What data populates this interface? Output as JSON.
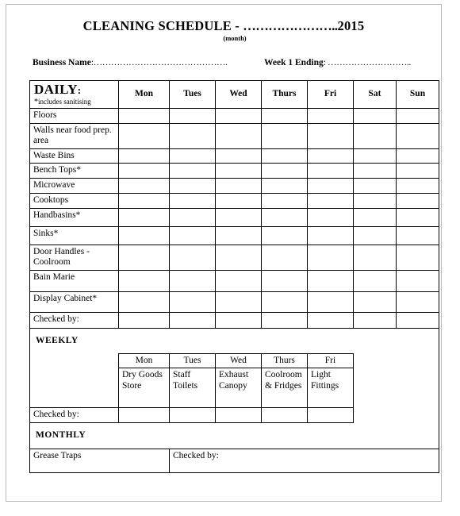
{
  "document": {
    "title_prefix": "CLEANING SCHEDULE - ",
    "title_dots": "…………………..",
    "title_year": "2015",
    "month_note": "(month)",
    "business_name_label": "Business Name",
    "business_name_dots": ":……………………………………….",
    "week_ending_label": "Week 1 Ending",
    "week_ending_dots": ": ……………………….."
  },
  "daily": {
    "heading": "DAILY",
    "heading_colon": ":",
    "note_star": "*",
    "note": "includes sanitising",
    "days": [
      "Mon",
      "Tues",
      "Wed",
      "Thurs",
      "Fri",
      "Sat",
      "Sun"
    ],
    "tasks": [
      "Floors",
      "Walls near food prep. area",
      "Waste Bins",
      "Bench Tops*",
      "Microwave",
      "Cooktops",
      "Handbasins*",
      "Sinks*",
      "Door Handles - Coolroom",
      "Bain Marie",
      "Display Cabinet*"
    ],
    "checked_by": "Checked by:"
  },
  "weekly": {
    "heading": "WEEKLY",
    "days": [
      "Mon",
      "Tues",
      "Wed",
      "Thurs",
      "Fri"
    ],
    "tasks": [
      "Dry Goods Store",
      "Staff Toilets",
      "Exhaust Canopy",
      "Coolroom & Fridges",
      "Light Fittings"
    ],
    "checked_by": "Checked by:"
  },
  "monthly": {
    "heading": "MONTHLY",
    "task": "Grease Traps",
    "checked_by": "Checked by:"
  }
}
